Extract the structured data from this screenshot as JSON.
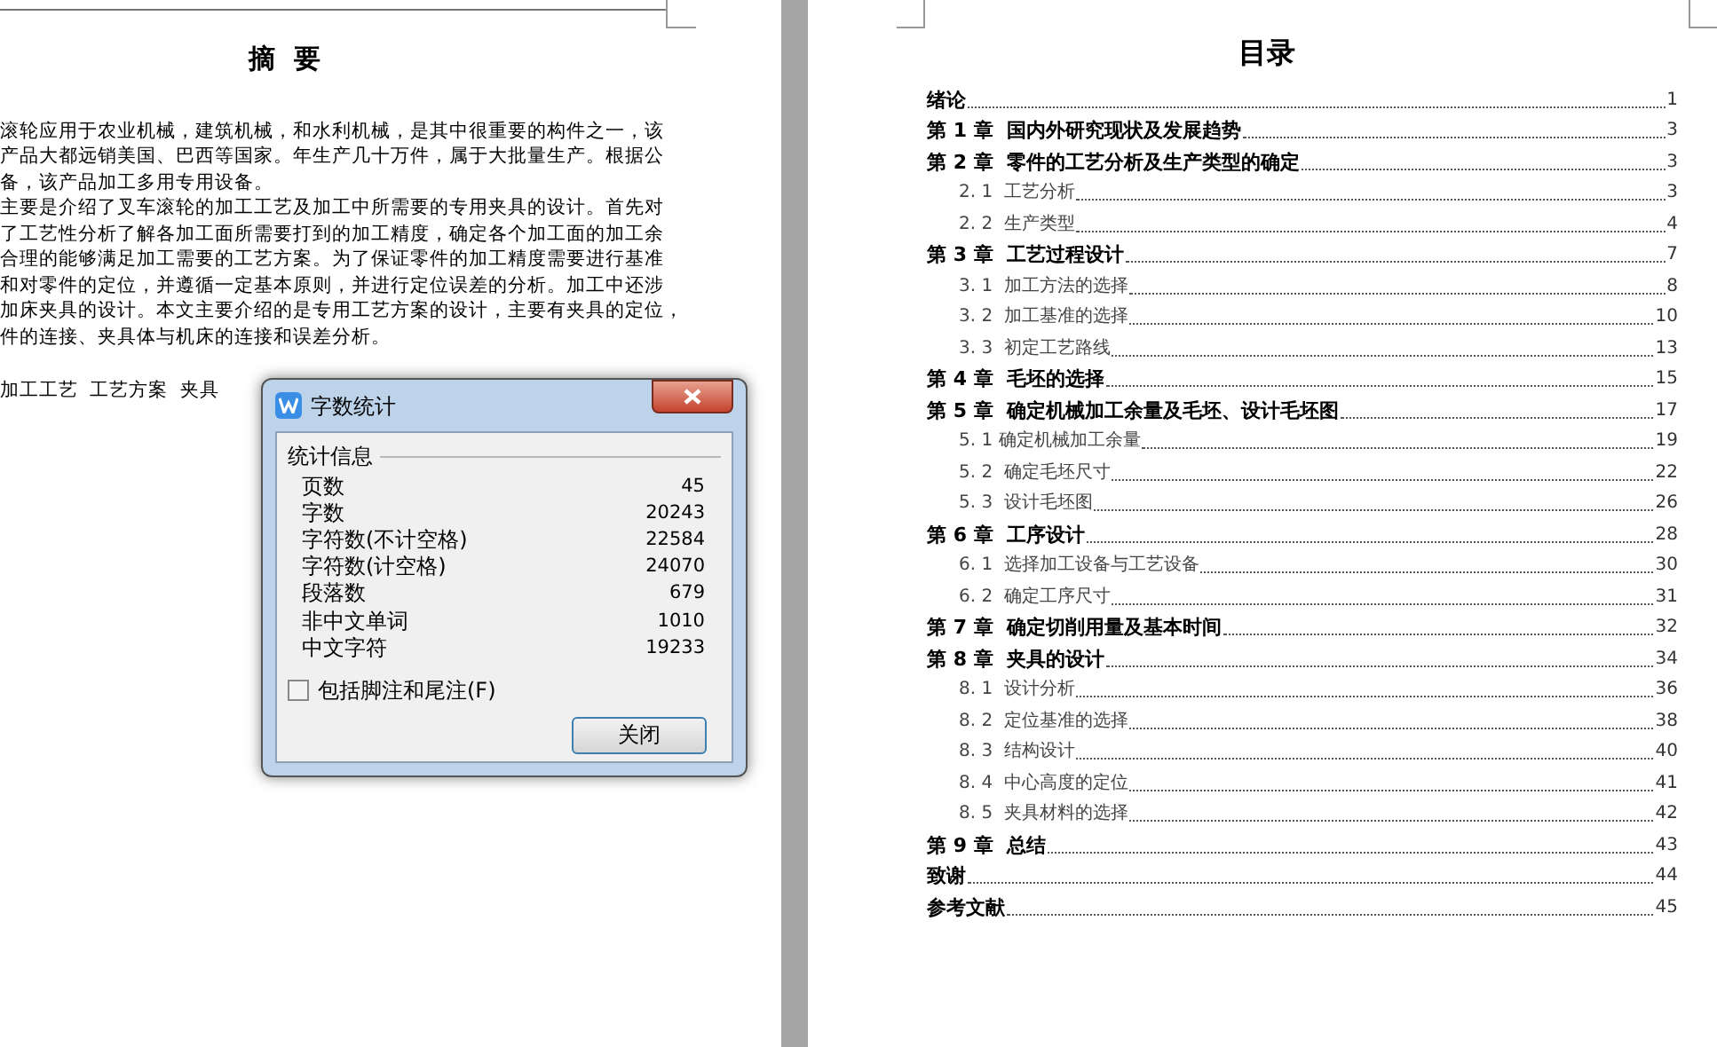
{
  "left_page": {
    "title": "摘  要",
    "lines": [
      "滚轮应用于农业机械，建筑机械，和水利机械，是其中很重要的构件之一，该",
      "产品大都远销美国、巴西等国家。年生产几十万件，属于大批量生产。根据公",
      "备，该产品加工多用专用设备。",
      "主要是介绍了叉车滚轮的加工工艺及加工中所需要的专用夹具的设计。首先对",
      "了工艺性分析了解各加工面所需要打到的加工精度，确定各个加工面的加工余",
      "合理的能够满足加工需要的工艺方案。为了保证零件的加工精度需要进行基准",
      "和对零件的定位，并遵循一定基本原则，并进行定位误差的分析。加工中还涉",
      "加床夹具的设计。本文主要介绍的是专用工艺方案的设计，主要有夹具的定位，",
      "件的连接、夹具体与机床的连接和误差分析。"
    ],
    "keywords": "加工工艺  工艺方案  夹具"
  },
  "dialog": {
    "title": "字数统计",
    "section": "统计信息",
    "stats": [
      {
        "label": "页数",
        "value": "45"
      },
      {
        "label": "字数",
        "value": "20243"
      },
      {
        "label": "字符数(不计空格)",
        "value": "22584"
      },
      {
        "label": "字符数(计空格)",
        "value": "24070"
      },
      {
        "label": "段落数",
        "value": "679"
      },
      {
        "label": "非中文单词",
        "value": "1010"
      },
      {
        "label": "中文字符",
        "value": "19233"
      }
    ],
    "checkbox": {
      "label": "包括脚注和尾注(F)",
      "checked": false
    },
    "button": "关闭"
  },
  "toc": {
    "title": "目录",
    "entries": [
      {
        "kind": "chapter",
        "label": "绪论",
        "page": "1"
      },
      {
        "kind": "chapter",
        "label": "第 1 章  国内外研究现状及发展趋势",
        "page": "3"
      },
      {
        "kind": "chapter",
        "label": "第 2 章  零件的工艺分析及生产类型的确定",
        "page": "3"
      },
      {
        "kind": "section",
        "label": "2. 1  工艺分析",
        "page": "3"
      },
      {
        "kind": "section",
        "label": "2. 2  生产类型",
        "page": "4"
      },
      {
        "kind": "chapter",
        "label": "第 3 章  工艺过程设计",
        "page": "7"
      },
      {
        "kind": "section",
        "label": "3. 1  加工方法的选择",
        "page": "8"
      },
      {
        "kind": "section",
        "label": "3. 2  加工基准的选择",
        "page": "10"
      },
      {
        "kind": "section",
        "label": "3. 3  初定工艺路线",
        "page": "13"
      },
      {
        "kind": "chapter",
        "label": "第 4 章  毛坯的选择",
        "page": "15"
      },
      {
        "kind": "chapter",
        "label": "第 5 章  确定机械加工余量及毛坯、设计毛坯图",
        "page": "17"
      },
      {
        "kind": "section",
        "label": "5. 1 确定机械加工余量",
        "page": "19"
      },
      {
        "kind": "section",
        "label": "5. 2  确定毛坯尺寸",
        "page": "22"
      },
      {
        "kind": "section",
        "label": "5. 3  设计毛坯图",
        "page": "26"
      },
      {
        "kind": "chapter",
        "label": "第 6 章  工序设计",
        "page": "28"
      },
      {
        "kind": "section",
        "label": "6. 1  选择加工设备与工艺设备",
        "page": "30"
      },
      {
        "kind": "section",
        "label": "6. 2  确定工序尺寸",
        "page": "31"
      },
      {
        "kind": "chapter",
        "label": "第 7 章  确定切削用量及基本时间",
        "page": "32"
      },
      {
        "kind": "chapter",
        "label": "第 8 章  夹具的设计",
        "page": "34"
      },
      {
        "kind": "section",
        "label": "8. 1  设计分析",
        "page": "36"
      },
      {
        "kind": "section",
        "label": "8. 2  定位基准的选择",
        "page": "38"
      },
      {
        "kind": "section",
        "label": "8. 3  结构设计",
        "page": "40"
      },
      {
        "kind": "section",
        "label": "8. 4  中心高度的定位",
        "page": "41"
      },
      {
        "kind": "section",
        "label": "8. 5  夹具材料的选择",
        "page": "42"
      },
      {
        "kind": "chapter",
        "label": "第 9 章  总结",
        "page": "43"
      },
      {
        "kind": "chapter",
        "label": "致谢",
        "page": "44"
      },
      {
        "kind": "chapter",
        "label": "参考文献",
        "page": "45"
      }
    ]
  }
}
